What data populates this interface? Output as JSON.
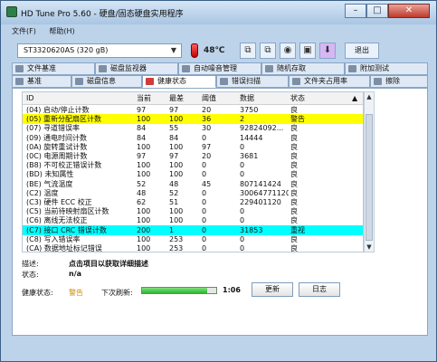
{
  "window": {
    "title": "HD Tune Pro 5.60 - 硬盘/固态硬盘实用程序",
    "controls": {
      "minimize": "–",
      "maximize": "□",
      "close": "✕"
    }
  },
  "menu": [
    "文件(F)",
    "帮助(H)"
  ],
  "toolbar": {
    "drive": "ST3320620AS (320 gB)",
    "temperature": "48℃",
    "exit_label": "退出",
    "icons": [
      "copy-icon",
      "copy-icon",
      "camera-icon",
      "save-icon",
      "download-icon"
    ]
  },
  "tabs": {
    "row1": [
      {
        "label": "文件基准",
        "icon": "file-icon"
      },
      {
        "label": "磁盘监视器",
        "icon": "monitor-icon"
      },
      {
        "label": "自动噪音管理",
        "icon": "speaker-icon"
      },
      {
        "label": "随机存取",
        "icon": "random-icon"
      },
      {
        "label": "附加测试",
        "icon": "test-icon"
      }
    ],
    "row2": [
      {
        "label": "基准",
        "icon": "bench-icon"
      },
      {
        "label": "磁盘信息",
        "icon": "info-icon"
      },
      {
        "label": "健康状态",
        "icon": "health-icon",
        "active": true
      },
      {
        "label": "错误扫描",
        "icon": "scan-icon"
      },
      {
        "label": "文件夹占用率",
        "icon": "folder-icon"
      },
      {
        "label": "擦除",
        "icon": "erase-icon"
      }
    ]
  },
  "table": {
    "columns": [
      "ID",
      "当前",
      "最差",
      "阈值",
      "数据",
      "状态"
    ],
    "rows": [
      {
        "id": "(04) 启动/停止计数",
        "cur": "97",
        "worst": "97",
        "thr": "20",
        "data": "3750",
        "status": "良",
        "hl": ""
      },
      {
        "id": "(05) 重新分配扇区计数",
        "cur": "100",
        "worst": "100",
        "thr": "36",
        "data": "2",
        "status": "警告",
        "hl": "yellow"
      },
      {
        "id": "(07) 寻道错误率",
        "cur": "84",
        "worst": "55",
        "thr": "30",
        "data": "92824092...",
        "status": "良",
        "hl": ""
      },
      {
        "id": "(09) 通电时间计数",
        "cur": "84",
        "worst": "84",
        "thr": "0",
        "data": "14444",
        "status": "良",
        "hl": ""
      },
      {
        "id": "(0A) 旋转重试计数",
        "cur": "100",
        "worst": "100",
        "thr": "97",
        "data": "0",
        "status": "良",
        "hl": ""
      },
      {
        "id": "(0C) 电源周期计数",
        "cur": "97",
        "worst": "97",
        "thr": "20",
        "data": "3681",
        "status": "良",
        "hl": ""
      },
      {
        "id": "(B8) 不可校正错误计数",
        "cur": "100",
        "worst": "100",
        "thr": "0",
        "data": "0",
        "status": "良",
        "hl": ""
      },
      {
        "id": "(BD) 未知属性",
        "cur": "100",
        "worst": "100",
        "thr": "0",
        "data": "0",
        "status": "良",
        "hl": ""
      },
      {
        "id": "(BE) 气流温度",
        "cur": "52",
        "worst": "48",
        "thr": "45",
        "data": "807141424",
        "status": "良",
        "hl": ""
      },
      {
        "id": "(C2) 温度",
        "cur": "48",
        "worst": "52",
        "thr": "0",
        "data": "30064771120",
        "status": "良",
        "hl": ""
      },
      {
        "id": "(C3) 硬件 ECC 校正",
        "cur": "62",
        "worst": "51",
        "thr": "0",
        "data": "229401120",
        "status": "良",
        "hl": ""
      },
      {
        "id": "(C5) 当前待映射扇区计数",
        "cur": "100",
        "worst": "100",
        "thr": "0",
        "data": "0",
        "status": "良",
        "hl": ""
      },
      {
        "id": "(C6) 离线无法校正",
        "cur": "100",
        "worst": "100",
        "thr": "0",
        "data": "0",
        "status": "良",
        "hl": ""
      },
      {
        "id": "(C7) 接口 CRC 错误计数",
        "cur": "200",
        "worst": "1",
        "thr": "0",
        "data": "31853",
        "status": "重视",
        "hl": "cyan"
      },
      {
        "id": "(C8) 写入错误率",
        "cur": "100",
        "worst": "253",
        "thr": "0",
        "data": "0",
        "status": "良",
        "hl": ""
      },
      {
        "id": "(CA) 数据地址标记错误",
        "cur": "100",
        "worst": "253",
        "thr": "0",
        "data": "0",
        "status": "良",
        "hl": ""
      }
    ]
  },
  "details": {
    "desc_label": "描述:",
    "desc_value": "点击项目以获取详细描述",
    "state_label": "状态:",
    "state_value": "n/a"
  },
  "status": {
    "health_label": "健康状态:",
    "health_value": "警告",
    "refresh_label": "下次刷新:",
    "refresh_value": "1:06",
    "refresh_progress": 0.88,
    "update_label": "更新",
    "log_label": "日志",
    "colors": {
      "warning": "#d08a00",
      "highlight_yellow": "#ffff00",
      "highlight_cyan": "#00ffff"
    }
  }
}
